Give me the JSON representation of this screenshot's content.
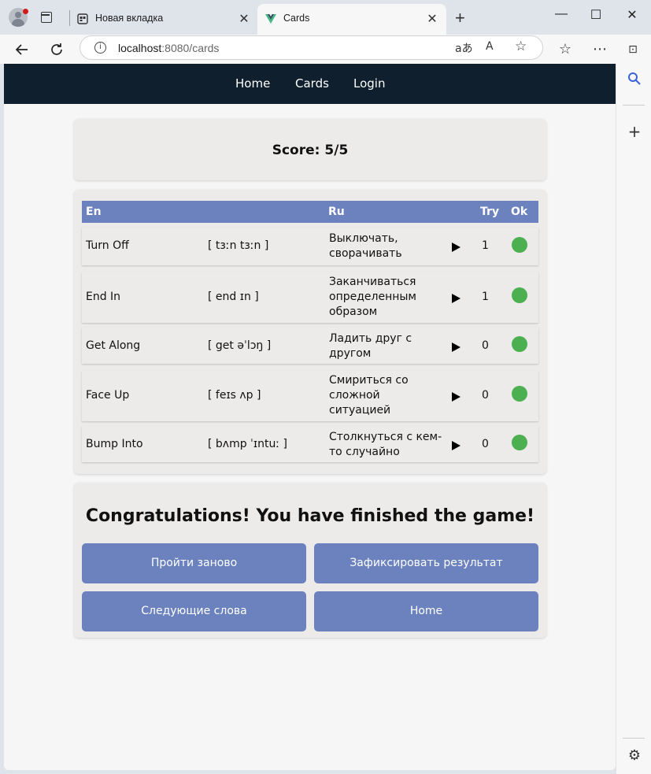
{
  "browser": {
    "tabs": [
      {
        "title": "Новая вкладка",
        "active": false
      },
      {
        "title": "Cards",
        "active": true
      }
    ],
    "address": {
      "host": "localhost",
      "path": ":8080/cards"
    },
    "icons": {
      "profile": "profile-avatar-icon",
      "tab_actions": "tab-actions-icon",
      "new_tab": "plus-icon",
      "back": "back-arrow-icon",
      "reload": "reload-icon",
      "info": "site-info-icon",
      "translate": "translate-icon",
      "read_aloud": "read-aloud-icon",
      "favorite": "star-icon",
      "favorites": "favorites-icon",
      "more": "more-icon",
      "split": "split-screen-icon",
      "search": "search-icon",
      "add": "plus-icon",
      "settings": "gear-icon"
    },
    "window_controls": {
      "minimize": "—",
      "maximize": "☐",
      "close": "✕"
    }
  },
  "nav": {
    "items": [
      {
        "label": "Home"
      },
      {
        "label": "Cards"
      },
      {
        "label": "Login"
      }
    ]
  },
  "score": {
    "label": "Score:",
    "value": "5/5"
  },
  "table": {
    "headers": {
      "en": "En",
      "ru": "Ru",
      "try": "Try",
      "ok": "Ok"
    },
    "rows": [
      {
        "en": "Turn Off",
        "transcription": "[ tɜːn tɜːn ]",
        "ru": "Выключать, сворачивать",
        "try": "1",
        "ok": true
      },
      {
        "en": "End In",
        "transcription": "[ end ɪn ]",
        "ru": "Заканчиваться определенным образом",
        "try": "1",
        "ok": true
      },
      {
        "en": "Get Along",
        "transcription": "[ get əˈlɔŋ ]",
        "ru": "Ладить друг с другом",
        "try": "0",
        "ok": true
      },
      {
        "en": "Face Up",
        "transcription": "[ feɪs ʌp ]",
        "ru": "Смириться со сложной ситуацией",
        "try": "0",
        "ok": true
      },
      {
        "en": "Bump Into",
        "transcription": "[ bʌmp ˈɪntuː ]",
        "ru": "Столкнуться с кем-то случайно",
        "try": "0",
        "ok": true
      }
    ]
  },
  "finish": {
    "message": "Congratulations! You have finished the game!",
    "buttons": {
      "retry": "Пройти заново",
      "save": "Зафиксировать результат",
      "next": "Следующие слова",
      "home": "Home"
    }
  },
  "colors": {
    "navbar": "#0f1f2e",
    "accent": "#6b82be",
    "ok": "#4caf50",
    "card": "#ecebea"
  }
}
